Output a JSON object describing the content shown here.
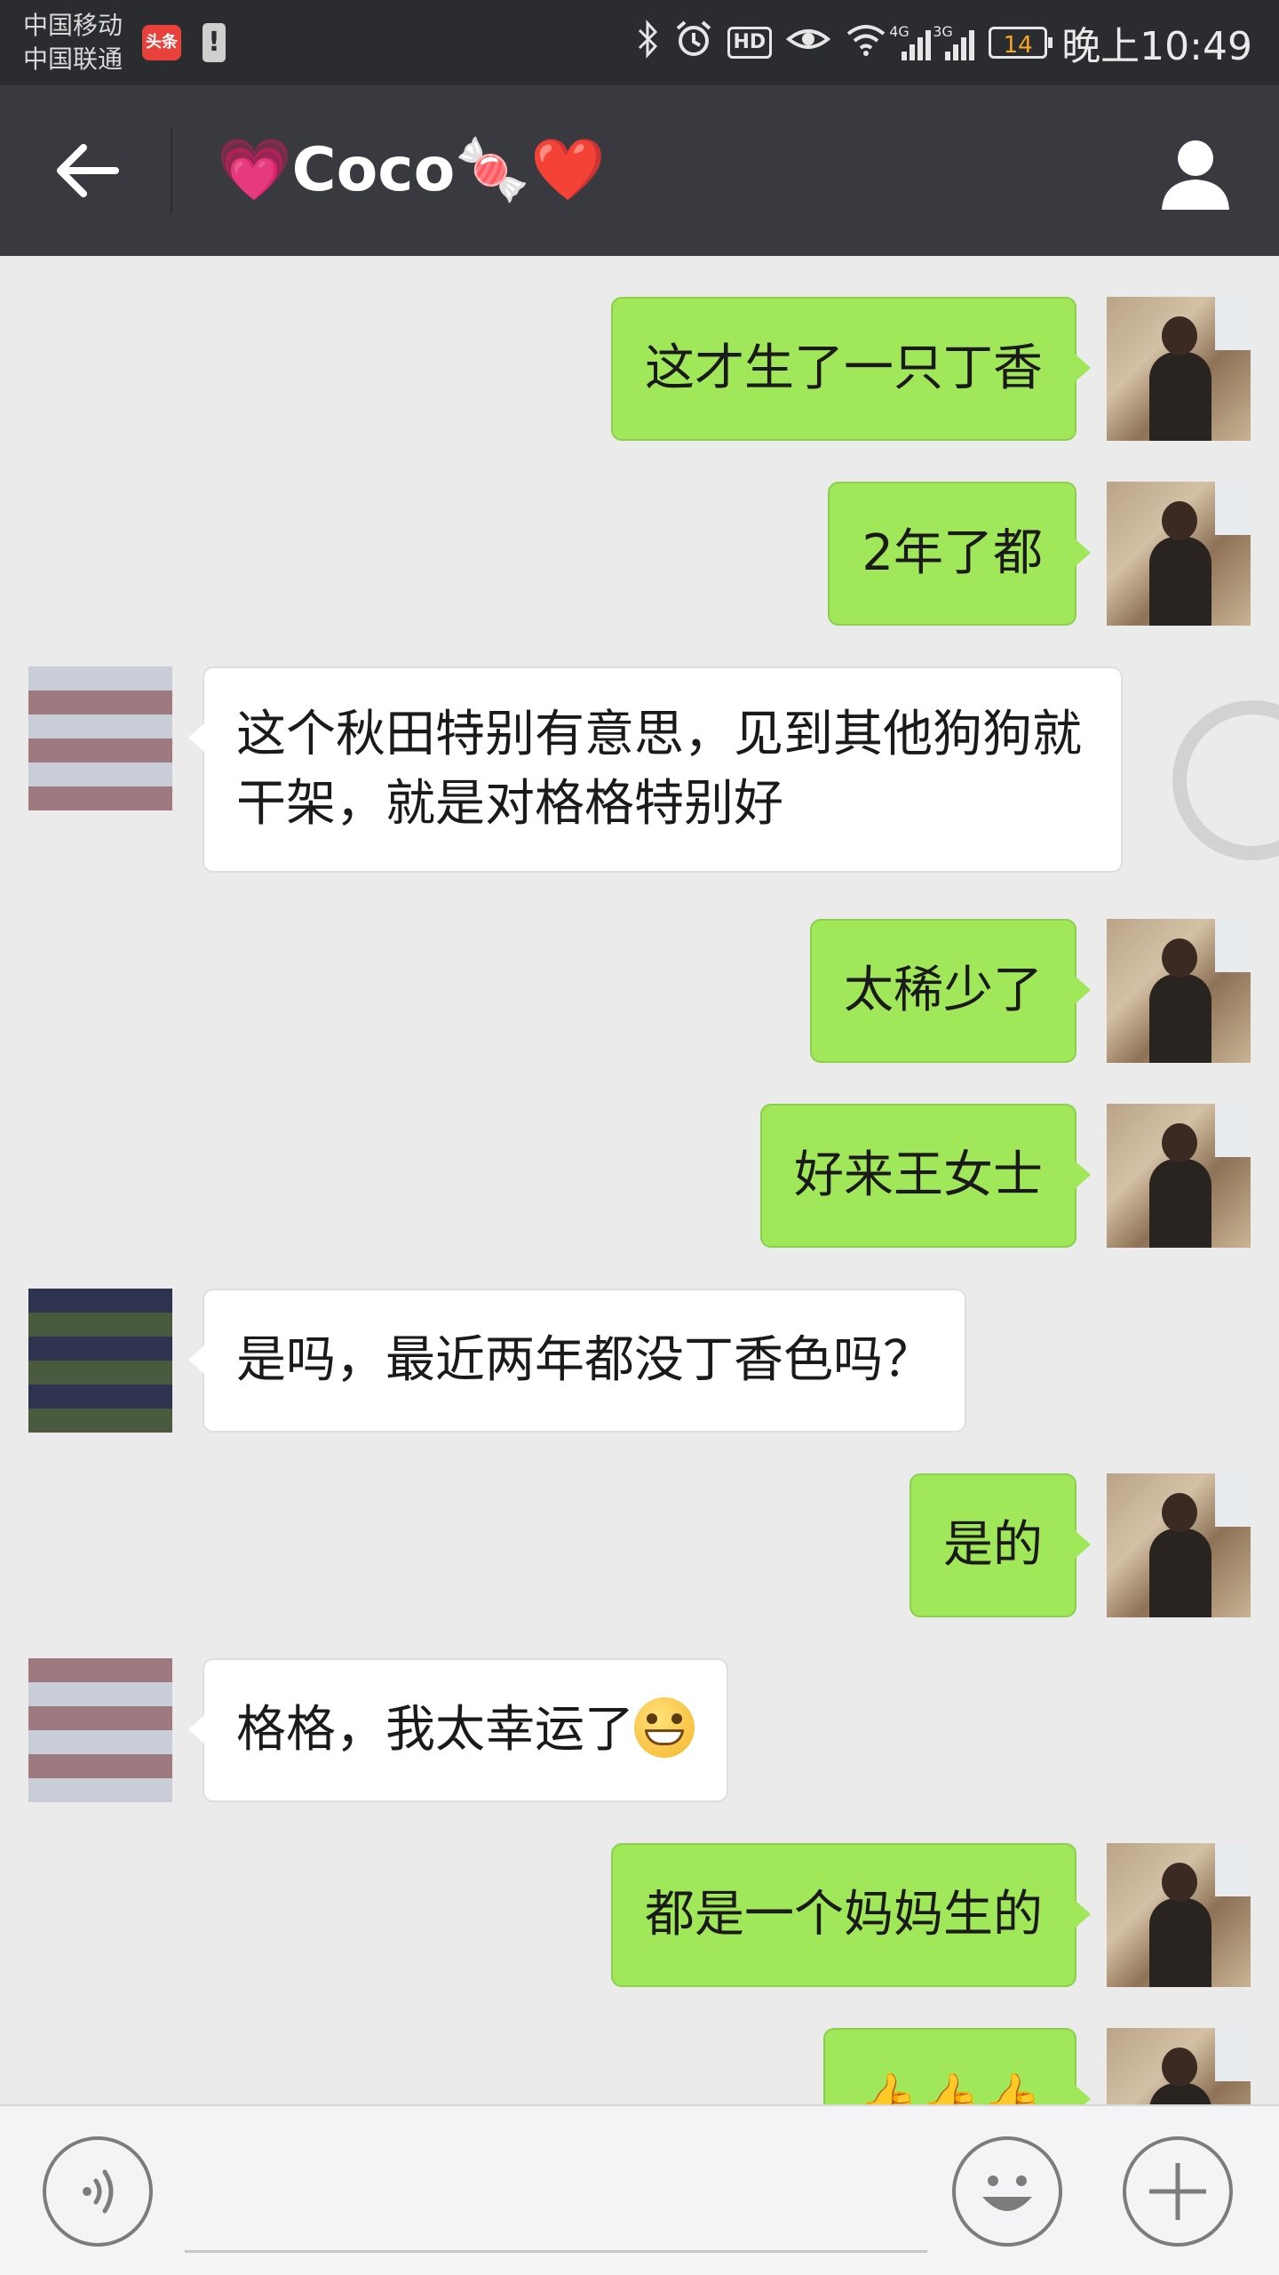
{
  "status_bar": {
    "carrier_1": "中国移动",
    "carrier_2": "中国联通",
    "app_notification_icon": "头条",
    "alert_icon": "!",
    "hd_label": "HD",
    "net_1": "4G",
    "net_2": "3G",
    "battery": "14",
    "time": "晚上10:49",
    "icons": [
      "bluetooth-icon",
      "alarm-icon",
      "eye-icon",
      "wifi-icon",
      "signal-icon",
      "battery-icon"
    ]
  },
  "header": {
    "title": "Coco",
    "title_emoji_left": "💗",
    "title_emoji_right_1": "🍬",
    "title_emoji_right_2": "❤️",
    "back_icon": "back-arrow-icon",
    "profile_icon": "person-icon"
  },
  "messages": [
    {
      "sender": "me",
      "text": "这才生了一只丁香"
    },
    {
      "sender": "me",
      "text": "2年了都"
    },
    {
      "sender": "them",
      "text": "这个秋田特别有意思，见到其他狗狗就干架，就是对格格特别好"
    },
    {
      "sender": "me",
      "text": "太稀少了"
    },
    {
      "sender": "me",
      "text": "好来王女士"
    },
    {
      "sender": "them",
      "text": "是吗，最近两年都没丁香色吗？"
    },
    {
      "sender": "me",
      "text": "是的"
    },
    {
      "sender": "them",
      "text": "格格，我太幸运了",
      "emoji": "grinning-face"
    },
    {
      "sender": "me",
      "text": "都是一个妈妈生的"
    },
    {
      "sender": "me",
      "text": "👍👍👍"
    }
  ],
  "input_bar": {
    "placeholder": "",
    "voice_icon": "voice-icon",
    "emoji_icon": "emoji-icon",
    "plus_icon": "plus-icon"
  },
  "colors": {
    "header_bg": "#393a3f",
    "status_bg": "#2b2c2f",
    "chat_bg": "#ebebeb",
    "my_bubble": "#a0e75a",
    "their_bubble": "#ffffff"
  }
}
